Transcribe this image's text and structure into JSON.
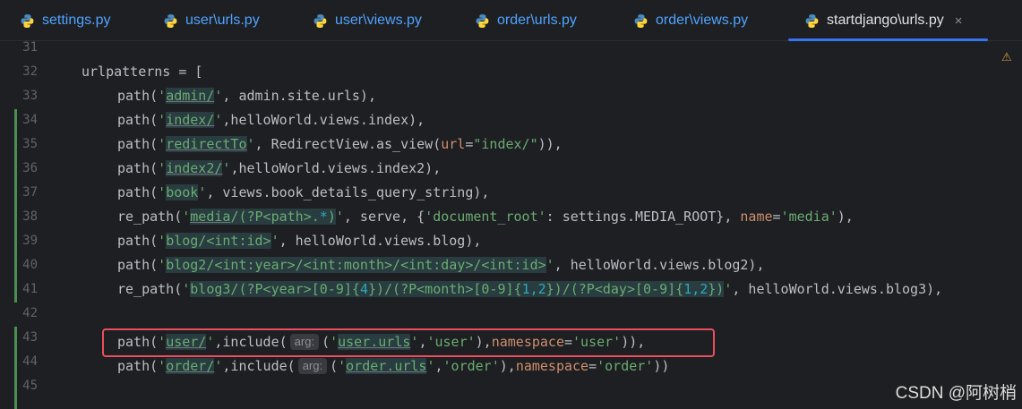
{
  "tabs": [
    {
      "label": "settings.py"
    },
    {
      "label": "user\\urls.py"
    },
    {
      "label": "user\\views.py"
    },
    {
      "label": "order\\urls.py"
    },
    {
      "label": "order\\views.py"
    },
    {
      "label": "startdjango\\urls.py",
      "active": true
    }
  ],
  "close_glyph": "×",
  "gutter": [
    "31",
    "32",
    "33",
    "34",
    "35",
    "36",
    "37",
    "38",
    "39",
    "40",
    "41",
    "42",
    "43",
    "44",
    "45"
  ],
  "code": {
    "l32": "urlpatterns = [",
    "hint_label": "arg:"
  },
  "warning_glyph": "⚠",
  "watermark": "CSDN @阿树梢",
  "colors": {
    "accent": "#3574f0",
    "highlight_box": "#e94f5c",
    "string": "#6aab73",
    "keyword_arg": "#cf8e6d"
  }
}
